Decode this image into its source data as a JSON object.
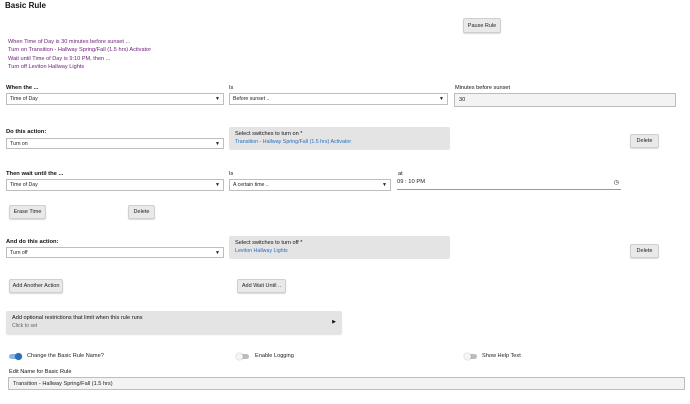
{
  "page_title": "Basic Rule",
  "pause_button": "Pause Rule",
  "summary": [
    "When Time of Day is 30 minutes before sunset ...",
    "Turn on Transition - Hallway Spring/Fall (1.5 hrs) Activator",
    "Wait until Time of Day is 9:10 PM, then ...",
    "Turn off Leviton Hallway Lights"
  ],
  "when": {
    "label": "When the ...",
    "trigger_value": "Time of Day",
    "is_label": "Is",
    "is_value": "Before sunset ..",
    "minutes_label": "Minutes before sunset",
    "minutes_value": "30"
  },
  "action1": {
    "label": "Do this action:",
    "value": "Turn on",
    "switches_header": "Select switches to turn on *",
    "switches_value": "Transition - Hallway Spring/Fall (1.5 hrs) Activator",
    "delete": "Delete"
  },
  "wait": {
    "label": "Then wait until the ...",
    "value": "Time of Day",
    "is_label": "Is",
    "is_value": "A certain time ..",
    "at_label": "at",
    "time_value": "09 : 10   PM",
    "erase": "Erase Time",
    "delete": "Delete"
  },
  "action2": {
    "label": "And do this action:",
    "value": "Turn off",
    "switches_header": "Select switches to turn off *",
    "switches_value": "Leviton Hallway Lights",
    "delete": "Delete"
  },
  "add_action": "Add Another Action",
  "add_wait": "Add Wait Until ..",
  "restrictions": {
    "title": "Add optional restrictions that limit when this rule runs",
    "sub": "Click to set"
  },
  "toggles": {
    "change_name": "Change the Basic Rule Name?",
    "logging": "Enable Logging",
    "help": "Show Help Text"
  },
  "edit_name": {
    "label": "Edit Name for Basic Rule",
    "value": "Transition - Hallway Spring/Fall (1.5 hrs)"
  },
  "colors": {
    "accent": "#2a6ebb",
    "summary": "#6b1a7a"
  }
}
